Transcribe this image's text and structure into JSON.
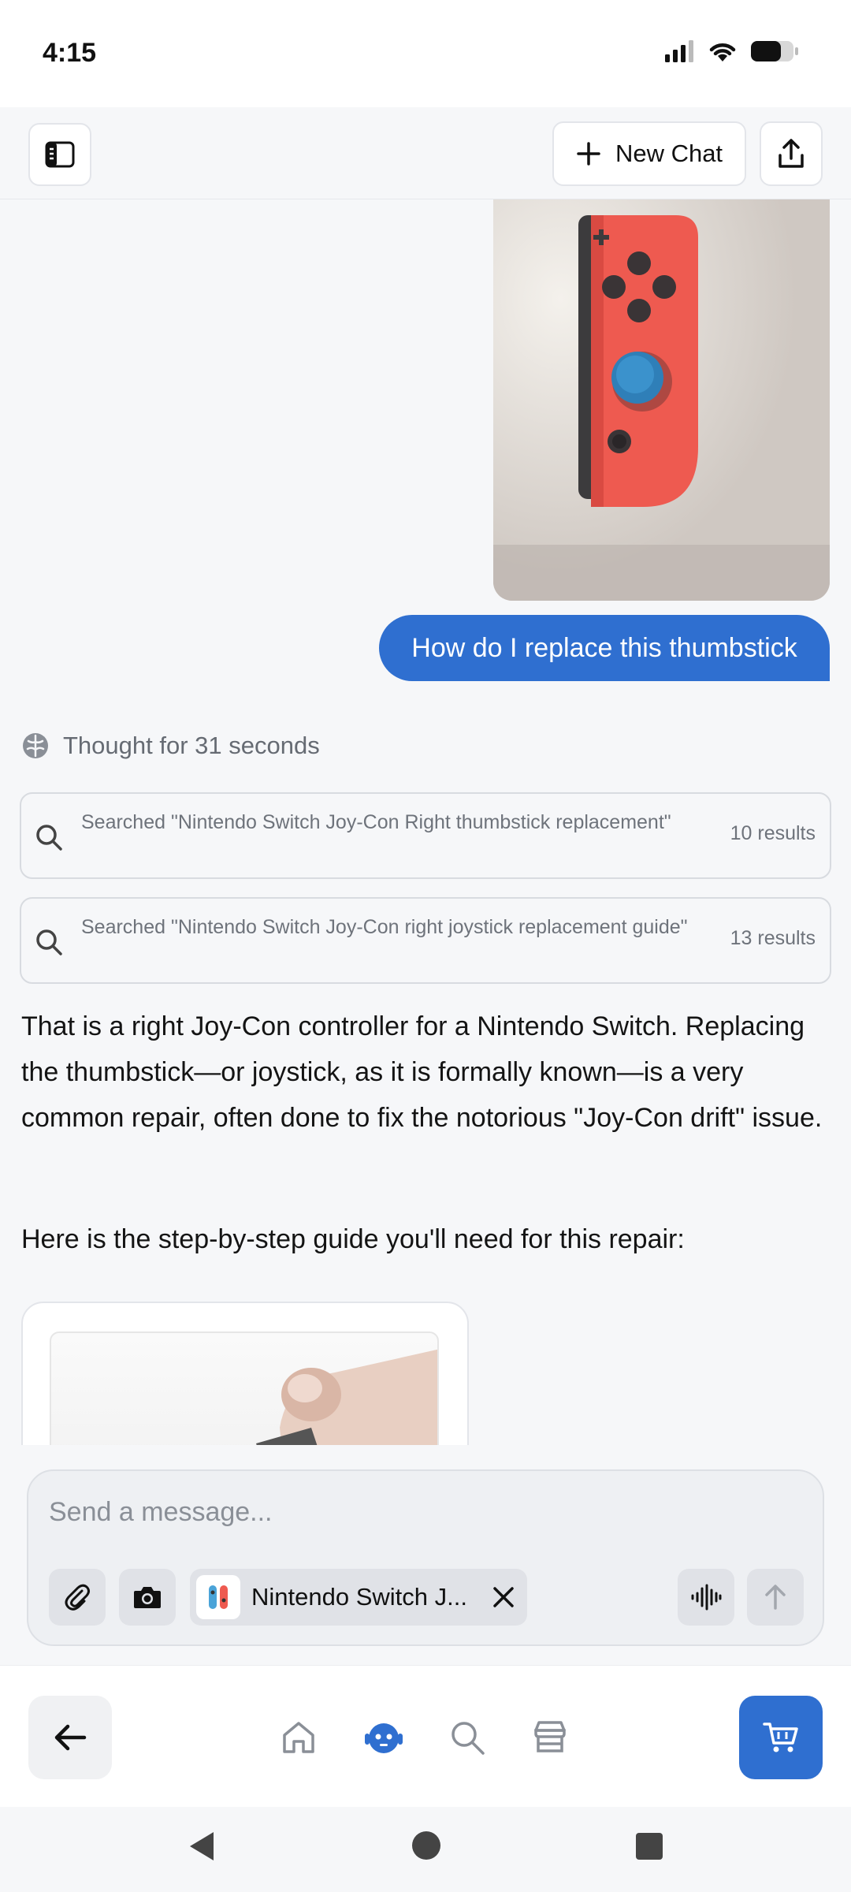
{
  "status_bar": {
    "time": "4:15"
  },
  "header": {
    "new_chat_label": "New Chat"
  },
  "chat": {
    "user_message": "How do I replace this thumbstick",
    "thought_label": "Thought for 31 seconds",
    "searches": [
      {
        "query": "Searched \"Nintendo Switch Joy-Con Right thumbstick replacement\"",
        "count": "10 results"
      },
      {
        "query": "Searched \"Nintendo Switch Joy-Con right joystick replacement guide\"",
        "count": "13 results"
      }
    ],
    "answer_paragraphs": [
      "That is a right Joy-Con controller for a Nintendo Switch. Replacing the thumbstick—or joystick, as it is formally known—is a very common repair, often done to fix the notorious \"Joy-Con drift\" issue.",
      "Here is the step-by-step guide you'll need for this repair:"
    ]
  },
  "composer": {
    "placeholder": "Send a message...",
    "chip_label": "Nintendo Switch J..."
  },
  "colors": {
    "accent": "#2f6fd0",
    "bubble_text": "#ffffff",
    "muted_text": "#6e737b"
  },
  "icons": {
    "sidebar": "sidebar-toggle-icon",
    "new_chat": "plus-icon",
    "share": "share-upload-icon",
    "thought": "brain-icon",
    "search": "search-icon",
    "attach": "paperclip-icon",
    "camera": "camera-icon",
    "chip_remove": "close-icon",
    "voice": "waveform-icon",
    "send": "arrow-up-icon",
    "back": "arrow-left-icon",
    "home": "home-icon",
    "assistant": "robot-icon",
    "explore": "search-icon",
    "store": "store-icon",
    "cart": "cart-icon"
  }
}
